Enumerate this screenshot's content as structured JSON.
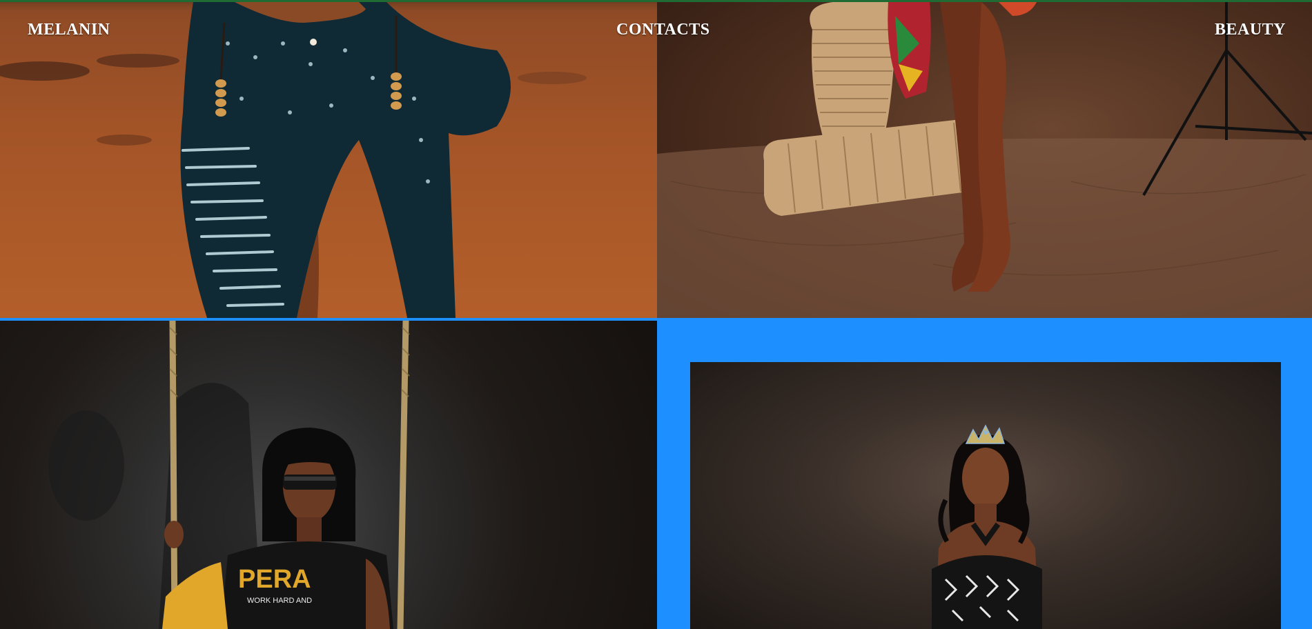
{
  "nav": {
    "left_label": "MELANIN",
    "center_label": "CONTACTS",
    "right_label": "BEAUTY"
  },
  "gallery": {
    "tiles": [
      {
        "subject": "model in indigo striped wrap skirt with beaded waist chain on red-earth ground"
      },
      {
        "subject": "bare legs standing beside woven baskets on draped brown backdrop with light stand"
      },
      {
        "subject": "model with dark visor glasses in yellow varsity jacket on rope swing"
      },
      {
        "subject": "woman wearing crown and black-and-white patterned halter top in dark studio"
      }
    ],
    "tile_3_jacket_text": [
      "PERA",
      "WORK HARD AND"
    ]
  },
  "colors": {
    "accent_blue": "#1e8fff",
    "top_line_green": "#1f6b33",
    "nav_text": "#ffffff"
  }
}
